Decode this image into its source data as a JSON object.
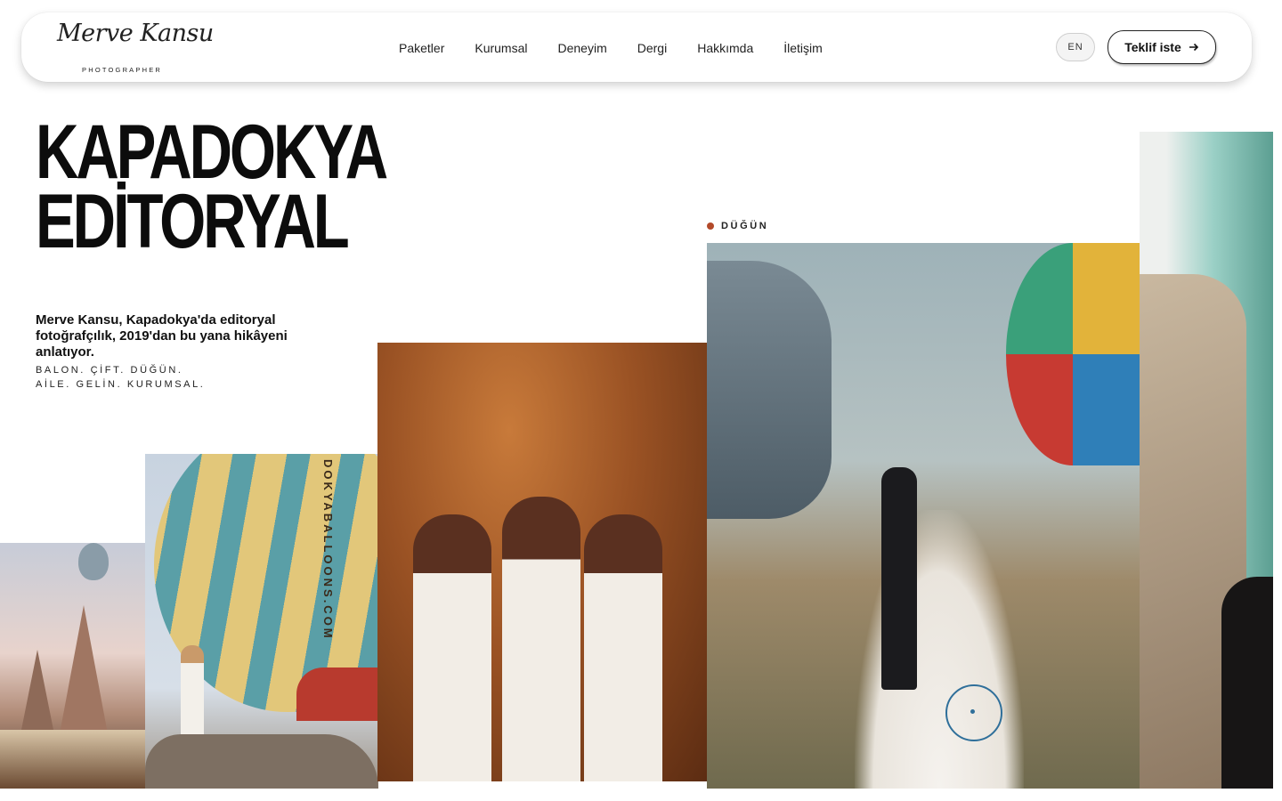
{
  "brand": {
    "name": "Merve Kansu",
    "tagline": "PHOTOGRAPHER"
  },
  "nav": {
    "items": [
      {
        "label": "Paketler"
      },
      {
        "label": "Kurumsal"
      },
      {
        "label": "Deneyim"
      },
      {
        "label": "Dergi"
      },
      {
        "label": "Hakkımda"
      },
      {
        "label": "İletişim"
      }
    ]
  },
  "header": {
    "lang_label": "EN",
    "cta_label": "Teklif iste"
  },
  "hero": {
    "title_line1": "KAPADOKYA",
    "title_line2": "EDİTORYAL",
    "intro": "Merve Kansu, Kapadokya'da editoryal fotoğrafçılık, 2019'dan bu yana hikâyeni anlatıyor.",
    "tags_line1": "BALON. ÇİFT. DÜĞÜN.",
    "tags_line2": "AİLE. GELİN. KURUMSAL."
  },
  "gallery": {
    "category_label": "DÜĞÜN",
    "balloon_text": "DOKYABALLOONS.COM"
  },
  "colors": {
    "accent_dot": "#b34a2a",
    "text": "#111111",
    "background": "#ffffff"
  }
}
